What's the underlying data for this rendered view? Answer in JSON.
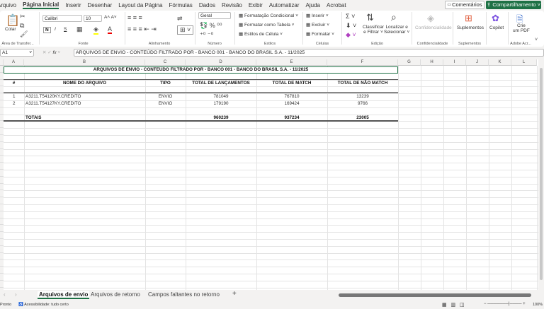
{
  "menu": {
    "tabs": [
      "Arquivo",
      "Página Inicial",
      "Inserir",
      "Desenhar",
      "Layout da Página",
      "Fórmulas",
      "Dados",
      "Revisão",
      "Exibir",
      "Automatizar",
      "Ajuda",
      "Acrobat"
    ],
    "active": 1,
    "comments": "Comentários",
    "share": "Compartilhamento"
  },
  "ribbon": {
    "paste": "Colar",
    "clipboard": "Área de Transfer...",
    "font_name": "Calibri",
    "font_size": "10",
    "font": "Fonte",
    "alignment": "Alinhamento",
    "number_format": "Geral",
    "number": "Número",
    "cond_format": "Formatação Condicional",
    "format_table": "Formatar como Tabela",
    "cell_styles": "Estilos de Célula",
    "styles": "Estilos",
    "insert": "Inserir",
    "delete": "Excluir",
    "format": "Formatar",
    "cells": "Células",
    "sort": "Classificar",
    "sort2": "e Filtrar",
    "find": "Localizar e",
    "find2": "Selecionar",
    "editing": "Edição",
    "confidentiality": "Confidencialidade",
    "addins": "Suplementos",
    "copilot": "Copilot",
    "pdf1": "Crie",
    "pdf2": "um PDF",
    "adobe": "Adobe Acr...",
    "bold": "N",
    "italic": "I",
    "underline": "S"
  },
  "formula": {
    "cell": "A1",
    "fx": "fx",
    "content": "ARQUIVOS DE ENVIO - CONTEÚDO FILTRADO POR - BANCO 001 - BANCO DO BRASIL S.A. - 11/2025"
  },
  "columns": [
    "A",
    "B",
    "C",
    "D",
    "E",
    "F",
    "G",
    "H",
    "I",
    "J",
    "K",
    "L"
  ],
  "table": {
    "title": "ARQUIVOS DE ENVIO - CONTEÚDO FILTRADO POR - BANCO 001 - BANCO DO BRASIL S.A. - 11/2025",
    "headers": [
      "#",
      "NOME DO ARQUIVO",
      "TIPO",
      "TOTAL DE LANÇAMENTOS",
      "TOTAL DE MATCH",
      "TOTAL DE NÃO MATCH"
    ],
    "rows": [
      [
        "1",
        "A3211.T54120KY.CREDITO",
        "ENVIO",
        "781049",
        "767810",
        "13239"
      ],
      [
        "2",
        "A3211.T54127KY.CREDITO",
        "ENVIO",
        "179190",
        "169424",
        "9766"
      ]
    ],
    "totals": [
      "",
      "TOTAIS",
      "",
      "960239",
      "937234",
      "23005"
    ]
  },
  "sheets": {
    "tabs": [
      "Arquivos de envio",
      "Arquivos de retorno",
      "Campos faltantes no retorno"
    ],
    "active": 0,
    "add": "+"
  },
  "status": {
    "ready": "Pronto",
    "accessibility": "Acessibilidade: tudo certo",
    "zoom": "100%"
  },
  "colors": {
    "accent": "#1e7145"
  }
}
